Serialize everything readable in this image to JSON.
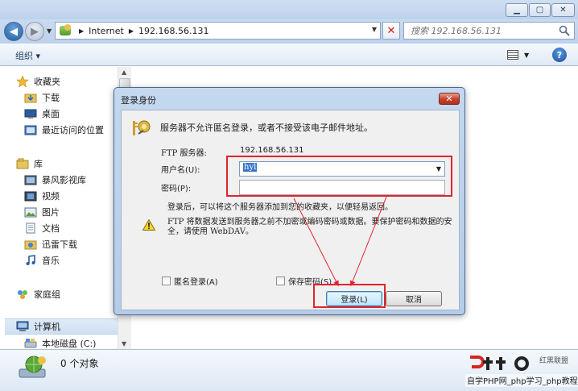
{
  "explorer": {
    "address": {
      "root": "Internet",
      "host": "192.168.56.131"
    },
    "search": {
      "placeholder": "搜索 192.168.56.131"
    },
    "toolbar": {
      "organize_label": "组织 ▾"
    },
    "nav": {
      "favorites": "收藏夹",
      "downloads": "下载",
      "desktop": "桌面",
      "recent": "最近访问的位置",
      "libraries": "库",
      "baofeng": "暴风影视库",
      "videos": "视频",
      "pictures": "图片",
      "documents": "文档",
      "xunlei": "迅雷下载",
      "music": "音乐",
      "homegroup": "家庭组",
      "computer": "计算机",
      "local_disk": "本地磁盘 (C:)"
    },
    "status": {
      "text": "0 个对象"
    }
  },
  "dialog": {
    "title": "登录身份",
    "message": "服务器不允许匿名登录，或者不接受该电子邮件地址。",
    "ftp_label": "FTP 服务器:",
    "ftp_server": "192.168.56.131",
    "username_label": "用户名(U):",
    "username_value": "hyl",
    "password_label": "密码(P):",
    "note": "登录后，可以将这个服务器添加到您的收藏夹，以便轻易返回。",
    "warning": "FTP 将数据发送到服务器之前不加密或编码密码或数据。要保护密码和数据的安全，请使用 WebDAV。",
    "anonymous_label": "匿名登录(A)",
    "save_password_label": "保存密码(S)",
    "login_label": "登录(L)",
    "cancel_label": "取消"
  },
  "watermark": {
    "tag": "红黑联盟",
    "text": "自学PHP网_php学习_php教程"
  }
}
